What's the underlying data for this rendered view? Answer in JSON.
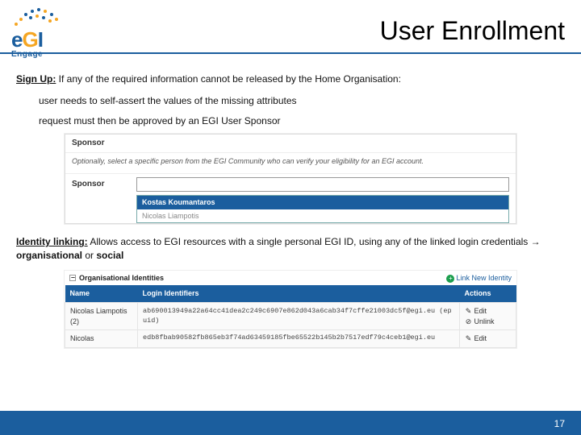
{
  "logo": {
    "brand_e": "e",
    "brand_g": "G",
    "brand_i": "I",
    "tagline": "Engage"
  },
  "title": "User Enrollment",
  "signup": {
    "label": "Sign Up:",
    "intro_rest": " If any of the required information cannot be released by the Home Organisation:",
    "bullet1": "user needs to self-assert the values of the missing attributes",
    "bullet2": "request must then be approved by an EGI User Sponsor"
  },
  "sponsor_panel": {
    "heading": "Sponsor",
    "subtext": "Optionally, select a specific person from the EGI Community who can verify your eligibility for an EGI account.",
    "field_label": "Sponsor",
    "dropdown": {
      "selected": "Kostas Koumantaros",
      "next": "Nicolas Liampotis"
    }
  },
  "identity": {
    "label": "Identity linking:",
    "rest_before_arrow": " Allows access to EGI resources with a single personal EGI ID, using any of the linked login credentials → ",
    "org_word": "organisational",
    "or": " or ",
    "social_word": "social"
  },
  "org_table": {
    "section": "Organisational Identities",
    "link_new": "Link New Identity",
    "cols": {
      "name": "Name",
      "login": "Login Identifiers",
      "actions": "Actions"
    },
    "rows": [
      {
        "name": "Nicolas Liampotis (2)",
        "login": "ab690013949a22a64cc41dea2c249c6907e862d043a6cab34f7cffe21003dc5f@egi.eu (epuid)",
        "a1": "Edit",
        "a2": "Unlink"
      },
      {
        "name": "Nicolas",
        "login": "edb8fbab90582fb865eb3f74ad63459185fbe65522b145b2b7517edf79c4ceb1@egi.eu",
        "a1": "Edit",
        "a2": ""
      }
    ]
  },
  "page_number": "17"
}
